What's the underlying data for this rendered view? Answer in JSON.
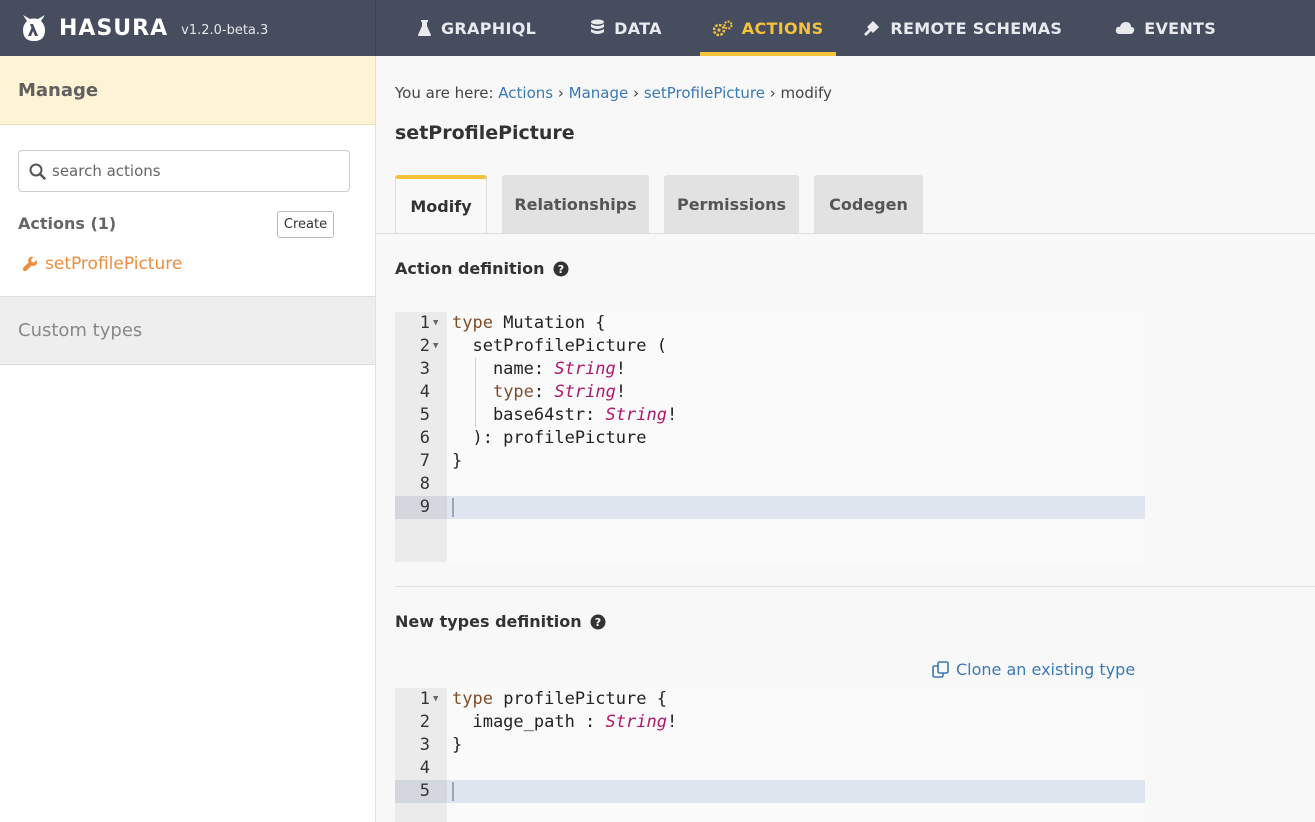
{
  "brand": {
    "name": "HASURA",
    "version": "v1.2.0-beta.3"
  },
  "nav": [
    {
      "label": "GRAPHIQL",
      "icon": "flask-icon",
      "active": false
    },
    {
      "label": "DATA",
      "icon": "database-icon",
      "active": false
    },
    {
      "label": "ACTIONS",
      "icon": "cogs-icon",
      "active": true
    },
    {
      "label": "REMOTE SCHEMAS",
      "icon": "plug-icon",
      "active": false
    },
    {
      "label": "EVENTS",
      "icon": "cloud-icon",
      "active": false
    }
  ],
  "sidebar": {
    "manage_label": "Manage",
    "search_placeholder": "search actions",
    "actions_title": "Actions (1)",
    "create_label": "Create",
    "action_items": [
      "setProfilePicture"
    ],
    "custom_types_label": "Custom types"
  },
  "main": {
    "breadcrumb": {
      "prefix": "You are here:",
      "items": [
        "Actions",
        "Manage",
        "setProfilePicture"
      ],
      "current": "modify"
    },
    "title": "setProfilePicture",
    "tabs": [
      {
        "label": "Modify",
        "active": true
      },
      {
        "label": "Relationships",
        "active": false
      },
      {
        "label": "Permissions",
        "active": false
      },
      {
        "label": "Codegen",
        "active": false
      }
    ],
    "action_definition": {
      "title": "Action definition",
      "lines": [
        {
          "n": "1",
          "fold": true,
          "code": "type Mutation {"
        },
        {
          "n": "2",
          "fold": true,
          "code": "  setProfilePicture ("
        },
        {
          "n": "3",
          "fold": false,
          "code": "    name: String!"
        },
        {
          "n": "4",
          "fold": false,
          "code": "    type: String!"
        },
        {
          "n": "5",
          "fold": false,
          "code": "    base64str: String!"
        },
        {
          "n": "6",
          "fold": false,
          "code": "  ): profilePicture"
        },
        {
          "n": "7",
          "fold": false,
          "code": "}"
        },
        {
          "n": "8",
          "fold": false,
          "code": ""
        },
        {
          "n": "9",
          "fold": false,
          "code": "",
          "current": true
        }
      ]
    },
    "types_definition": {
      "title": "New types definition",
      "clone_label": "Clone an existing type",
      "lines": [
        {
          "n": "1",
          "fold": true,
          "code": "type profilePicture {"
        },
        {
          "n": "2",
          "fold": false,
          "code": "  image_path : String!"
        },
        {
          "n": "3",
          "fold": false,
          "code": "}"
        },
        {
          "n": "4",
          "fold": false,
          "code": ""
        },
        {
          "n": "5",
          "fold": false,
          "code": "",
          "current": true
        }
      ]
    }
  },
  "colors": {
    "accent": "#f5c23b",
    "topbar": "#454d5e",
    "link": "#3a79b8",
    "action_item": "#f08c3a",
    "keyword": "#7f4c2a",
    "type": "#b0186e"
  }
}
